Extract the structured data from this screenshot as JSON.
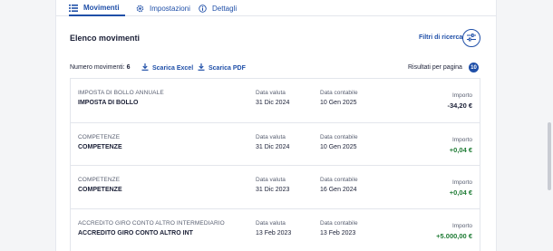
{
  "tabs": [
    {
      "label": "Movimenti",
      "icon": "list-icon",
      "active": true
    },
    {
      "label": "Impostazioni",
      "icon": "gear-icon",
      "active": false
    },
    {
      "label": "Dettagli",
      "icon": "info-icon",
      "active": false
    }
  ],
  "header": {
    "title": "Elenco movimenti",
    "filter_label": "Filtri di ricerca",
    "filter_icon": "sliders-icon"
  },
  "toolbar": {
    "count_label": "Numero movimenti:",
    "count_value": "6",
    "excel_label": "Scarica Excel",
    "pdf_label": "Scarica PDF",
    "per_page_label": "Risultati per pagina",
    "per_page_value": "10"
  },
  "columns": {
    "valuta": "Data valuta",
    "contabile": "Data contabile",
    "importo": "Importo"
  },
  "movements": [
    {
      "category": "IMPOSTA DI BOLLO ANNUALE",
      "description": "IMPOSTA DI BOLLO",
      "valuta": "31 Dic 2024",
      "contabile": "10 Gen 2025",
      "amount": "-34,20 €",
      "positive": false
    },
    {
      "category": "COMPETENZE",
      "description": "COMPETENZE",
      "valuta": "31 Dic 2024",
      "contabile": "10 Gen 2025",
      "amount": "+0,04 €",
      "positive": true
    },
    {
      "category": "COMPETENZE",
      "description": "COMPETENZE",
      "valuta": "31 Dic 2023",
      "contabile": "16 Gen 2024",
      "amount": "+0,04 €",
      "positive": true
    },
    {
      "category": "ACCREDITO GIRO CONTO ALTRO INTERMEDIARIO",
      "description": "ACCREDITO GIRO CONTO ALTRO INT",
      "valuta": "13 Feb 2023",
      "contabile": "13 Feb 2023",
      "amount": "+5.000,00 €",
      "positive": true
    }
  ],
  "colors": {
    "accent": "#1f4fa8",
    "positive": "#1e7b34",
    "negative": "#1a1f36"
  }
}
